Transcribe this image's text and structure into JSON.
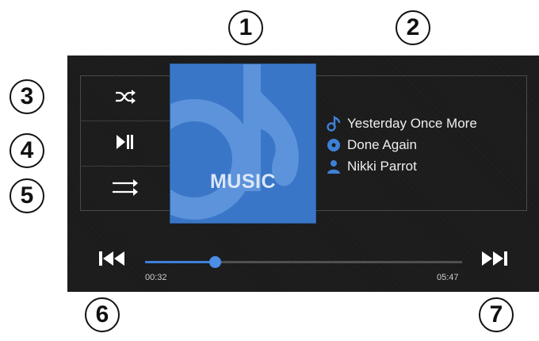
{
  "callouts": [
    "1",
    "2",
    "3",
    "4",
    "5",
    "6",
    "7"
  ],
  "controls": {
    "shuffle_icon": "shuffle-icon",
    "play_pause_icon": "play-pause-icon",
    "repeat_icon": "repeat-icon",
    "prev_icon": "skip-previous-icon",
    "next_icon": "skip-next-icon"
  },
  "album_art": {
    "label": "MUSIC"
  },
  "now_playing": {
    "title": "Yesterday Once More",
    "album": "Done Again",
    "artist": "Nikki Parrot"
  },
  "progress": {
    "elapsed": "00:32",
    "total": "05:47",
    "fraction": 0.22
  },
  "colors": {
    "accent": "#3e80d6",
    "art_blue": "#3a76c8",
    "background": "#1a1a1a"
  }
}
